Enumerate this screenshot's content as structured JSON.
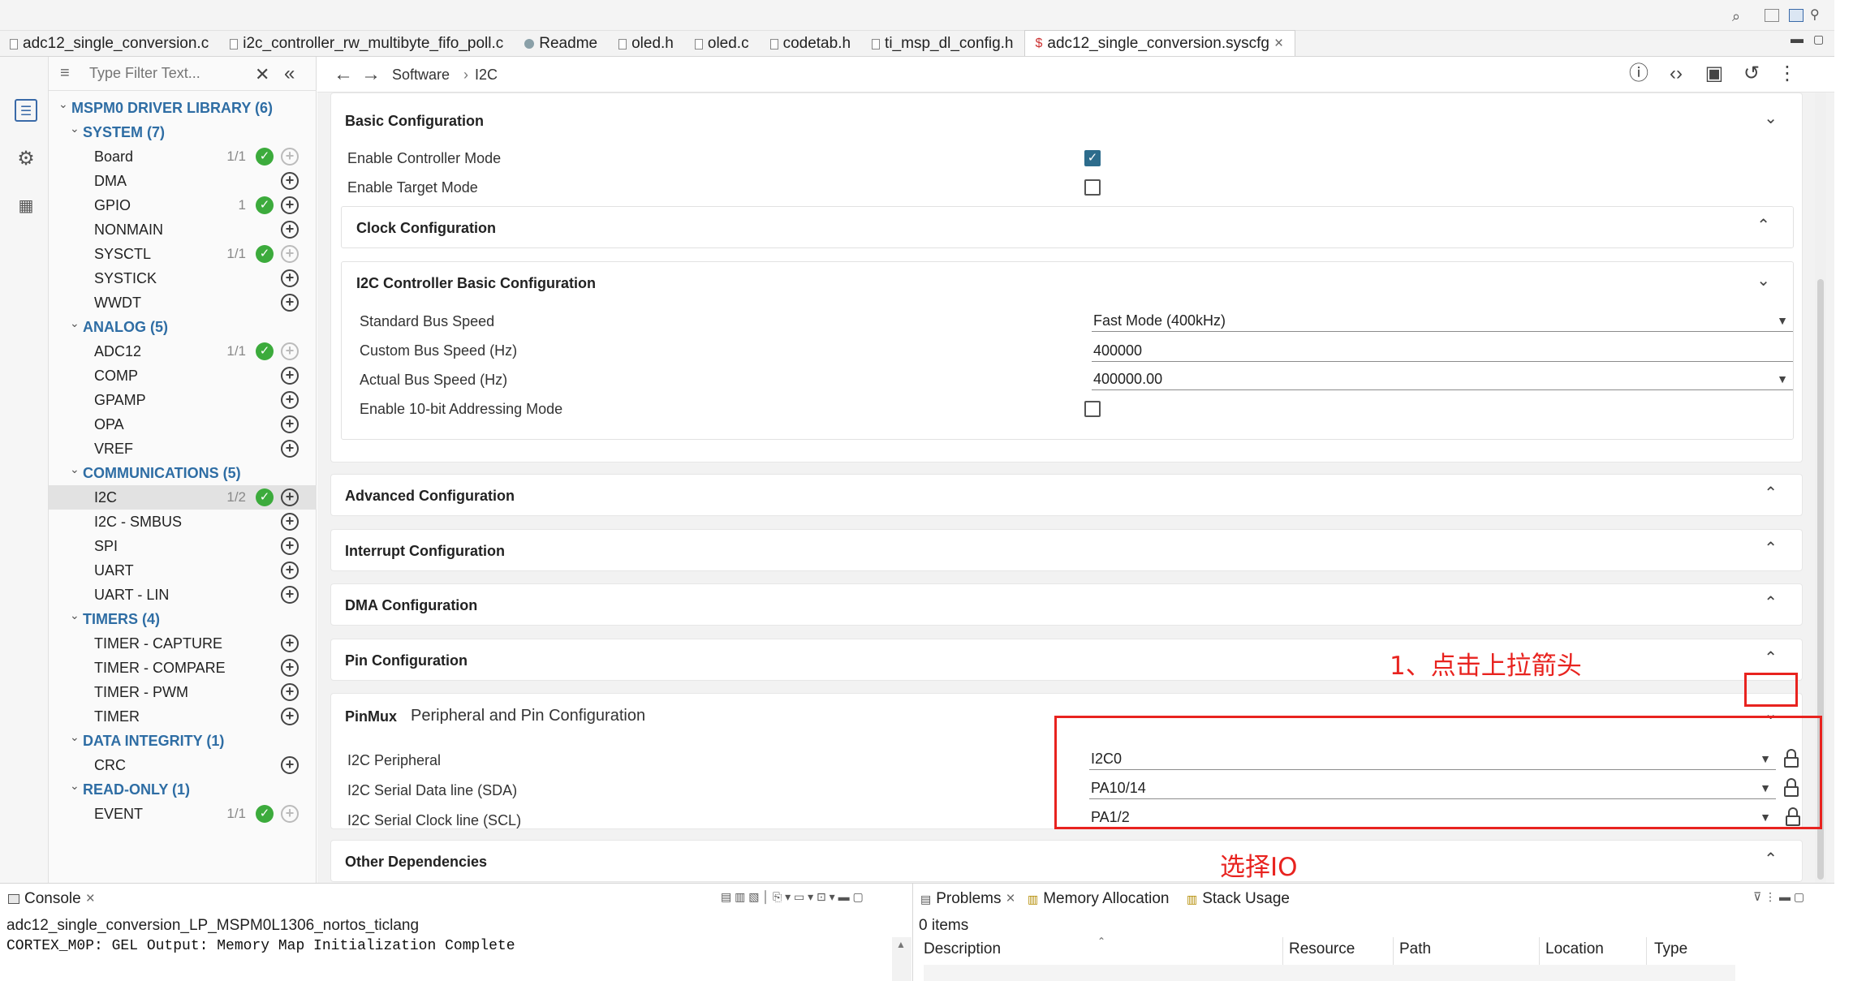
{
  "editor_tabs": [
    {
      "label": "adc12_single_conversion.c"
    },
    {
      "label": "i2c_controller_rw_multibyte_fifo_poll.c"
    },
    {
      "label": "Readme"
    },
    {
      "label": "oled.h"
    },
    {
      "label": "oled.c"
    },
    {
      "label": "codetab.h"
    },
    {
      "label": "ti_msp_dl_config.h"
    },
    {
      "label": "adc12_single_conversion.syscfg",
      "active": true,
      "close": "×"
    }
  ],
  "sidebar": {
    "filter_placeholder": "Type Filter Text...",
    "library_title": "MSPM0 DRIVER LIBRARY (6)",
    "categories": [
      {
        "title": "SYSTEM (7)",
        "items": [
          {
            "label": "Board",
            "count": "1/1",
            "ok": true
          },
          {
            "label": "DMA",
            "count": "",
            "ok": false
          },
          {
            "label": "GPIO",
            "count": "1",
            "ok": true
          },
          {
            "label": "NONMAIN",
            "count": "",
            "ok": false
          },
          {
            "label": "SYSCTL",
            "count": "1/1",
            "ok": true
          },
          {
            "label": "SYSTICK",
            "count": "",
            "ok": false
          },
          {
            "label": "WWDT",
            "count": "",
            "ok": false
          }
        ]
      },
      {
        "title": "ANALOG (5)",
        "items": [
          {
            "label": "ADC12",
            "count": "1/1",
            "ok": true
          },
          {
            "label": "COMP",
            "count": "",
            "ok": false
          },
          {
            "label": "GPAMP",
            "count": "",
            "ok": false
          },
          {
            "label": "OPA",
            "count": "",
            "ok": false
          },
          {
            "label": "VREF",
            "count": "",
            "ok": false
          }
        ]
      },
      {
        "title": "COMMUNICATIONS (5)",
        "items": [
          {
            "label": "I2C",
            "count": "1/2",
            "ok": true,
            "selected": true
          },
          {
            "label": "I2C - SMBUS",
            "count": "",
            "ok": false
          },
          {
            "label": "SPI",
            "count": "",
            "ok": false
          },
          {
            "label": "UART",
            "count": "",
            "ok": false
          },
          {
            "label": "UART - LIN",
            "count": "",
            "ok": false
          }
        ]
      },
      {
        "title": "TIMERS (4)",
        "items": [
          {
            "label": "TIMER - CAPTURE",
            "count": "",
            "ok": false
          },
          {
            "label": "TIMER - COMPARE",
            "count": "",
            "ok": false
          },
          {
            "label": "TIMER - PWM",
            "count": "",
            "ok": false
          },
          {
            "label": "TIMER",
            "count": "",
            "ok": false
          }
        ]
      },
      {
        "title": "DATA INTEGRITY (1)",
        "items": [
          {
            "label": "CRC",
            "count": "",
            "ok": false
          }
        ]
      },
      {
        "title": "READ-ONLY (1)",
        "items": [
          {
            "label": "EVENT",
            "count": "1/1",
            "ok": true
          }
        ]
      }
    ]
  },
  "breadcrumb": {
    "items": [
      "Software",
      "I2C"
    ],
    "separator": "›"
  },
  "config": {
    "basic": {
      "title": "Basic Configuration",
      "enable_controller": {
        "label": "Enable Controller Mode",
        "checked": true
      },
      "enable_target": {
        "label": "Enable Target Mode",
        "checked": false
      }
    },
    "clock": {
      "title": "Clock Configuration"
    },
    "controller_basic": {
      "title": "I2C Controller Basic Configuration",
      "std_bus_speed": {
        "label": "Standard Bus Speed",
        "value": "Fast Mode (400kHz)"
      },
      "custom_bus_speed": {
        "label": "Custom Bus Speed (Hz)",
        "value": "400000"
      },
      "actual_bus_speed": {
        "label": "Actual Bus Speed (Hz)",
        "value": "400000.00"
      },
      "addr10": {
        "label": "Enable 10-bit Addressing Mode",
        "checked": false
      }
    },
    "advanced": {
      "title": "Advanced Configuration"
    },
    "interrupt": {
      "title": "Interrupt Configuration"
    },
    "dma": {
      "title": "DMA Configuration"
    },
    "pin": {
      "title": "Pin Configuration"
    },
    "pinmux": {
      "title": "PinMux",
      "subtitle": "Peripheral and Pin Configuration",
      "peripheral": {
        "label": "I2C Peripheral",
        "value": "I2C0"
      },
      "sda": {
        "label": "I2C Serial Data line (SDA)",
        "value": "PA10/14"
      },
      "scl": {
        "label": "I2C Serial Clock line (SCL)",
        "value": "PA1/2"
      }
    },
    "other": {
      "title": "Other Dependencies"
    }
  },
  "annotations": {
    "step1": "1、点击上拉箭头",
    "select_io": "选择IO"
  },
  "console": {
    "tab": "Console",
    "project": "adc12_single_conversion_LP_MSPM0L1306_nortos_ticlang",
    "output": "CORTEX_M0P: GEL Output: Memory Map Initialization Complete"
  },
  "problems": {
    "tabs": [
      "Problems",
      "Memory Allocation",
      "Stack Usage"
    ],
    "count": "0 items",
    "columns": [
      "Description",
      "Resource",
      "Path",
      "Location",
      "Type"
    ]
  },
  "colors": {
    "accent": "#2e6da4",
    "ok": "#3cab3c",
    "annotation": "#e8231f",
    "checkbox": "#2d6c8c"
  }
}
